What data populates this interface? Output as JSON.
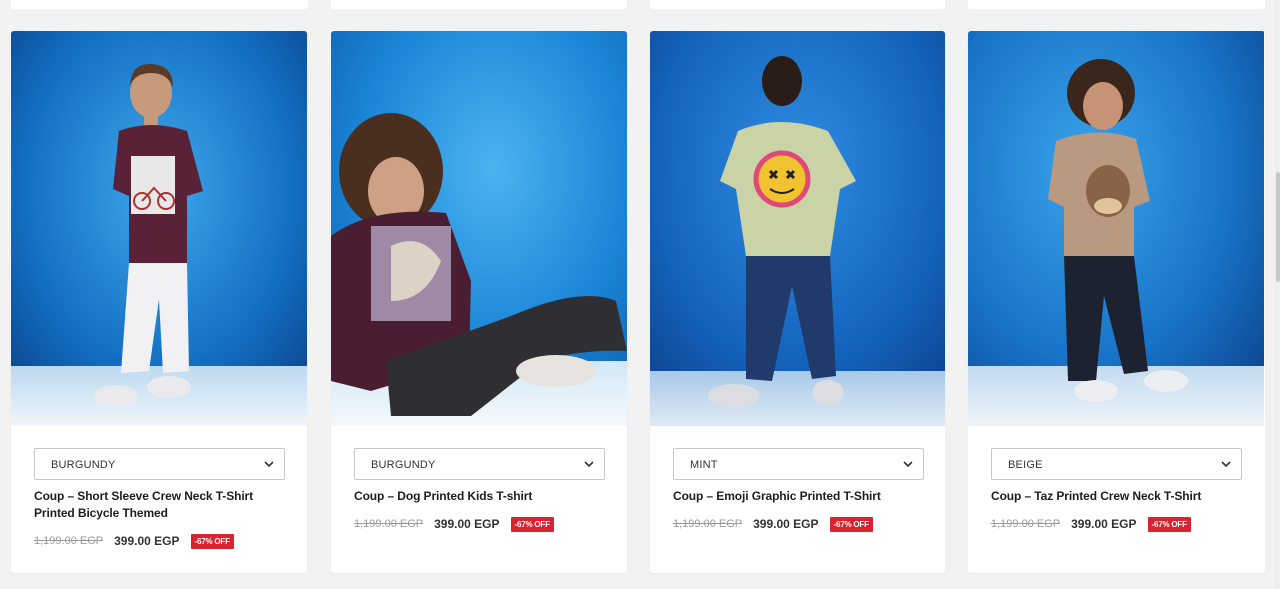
{
  "products": [
    {
      "color": "BURGUNDY",
      "title": "Coup – Short Sleeve Crew Neck T-Shirt Printed Bicycle Themed",
      "old_price": "1,199.00 EGP",
      "price": "399.00 EGP",
      "discount": "-67% OFF",
      "shirt_color": "#5a2236"
    },
    {
      "color": "BURGUNDY",
      "title": "Coup – Dog Printed Kids T-shirt",
      "old_price": "1,199.00 EGP",
      "price": "399.00 EGP",
      "discount": "-67% OFF",
      "shirt_color": "#4a1d33"
    },
    {
      "color": "MINT",
      "title": "Coup – Emoji Graphic Printed T-Shirt",
      "old_price": "1,199.00 EGP",
      "price": "399.00 EGP",
      "discount": "-67% OFF",
      "shirt_color": "#c9d3a6"
    },
    {
      "color": "BEIGE",
      "title": "Coup – Taz Printed Crew Neck T-Shirt",
      "old_price": "1,199.00 EGP",
      "price": "399.00 EGP",
      "discount": "-67% OFF",
      "shirt_color": "#b99a80"
    }
  ],
  "colors": {
    "discount_badge": "#d9232f",
    "backdrop_blue": "#1e86d9"
  }
}
